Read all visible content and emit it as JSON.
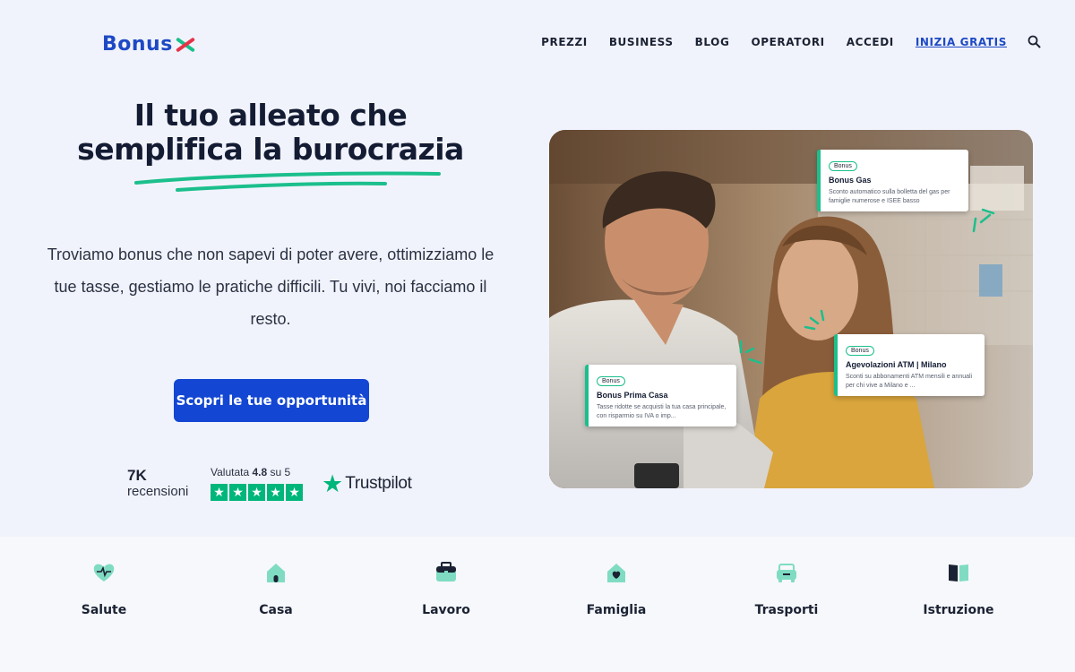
{
  "brand": {
    "name": "Bonus",
    "accent": "#1346d2",
    "green": "#1bbf8c",
    "red": "#e5344a"
  },
  "nav": {
    "items": [
      "PREZZI",
      "BUSINESS",
      "BLOG",
      "OPERATORI",
      "ACCEDI"
    ],
    "cta": "INIZIA GRATIS",
    "search_icon": "search-icon"
  },
  "hero": {
    "title_line1": "Il tuo alleato che",
    "title_line2": "semplifica la burocrazia",
    "subtitle": "Troviamo bonus che non sapevi di poter avere, ottimizziamo le tue tasse, gestiamo le pratiche difficili. Tu vivi, noi facciamo il resto.",
    "button": "Scopri le tue opportunità"
  },
  "trust": {
    "reviews_count": "7K",
    "reviews_label": "recensioni",
    "rating_prefix": "Valutata",
    "rating_value": "4.8",
    "rating_suffix": "su 5",
    "stars": 5,
    "provider": "Trustpilot"
  },
  "cards": [
    {
      "badge": "Bonus",
      "title": "Bonus Gas",
      "desc": "Sconto automatico sulla bolletta del gas per famiglie numerose e ISEE basso"
    },
    {
      "badge": "Bonus",
      "title": "Agevolazioni ATM | Milano",
      "desc": "Sconti su abbonamenti ATM mensili e annuali per chi vive a Milano e ..."
    },
    {
      "badge": "Bonus",
      "title": "Bonus Prima Casa",
      "desc": "Tasse ridotte se acquisti la tua casa principale, con risparmio su IVA o imp..."
    }
  ],
  "categories": [
    {
      "label": "Salute",
      "icon": "heart-pulse-icon"
    },
    {
      "label": "Casa",
      "icon": "house-icon"
    },
    {
      "label": "Lavoro",
      "icon": "briefcase-icon"
    },
    {
      "label": "Famiglia",
      "icon": "family-heart-icon"
    },
    {
      "label": "Trasporti",
      "icon": "car-icon"
    },
    {
      "label": "Istruzione",
      "icon": "book-icon"
    }
  ]
}
